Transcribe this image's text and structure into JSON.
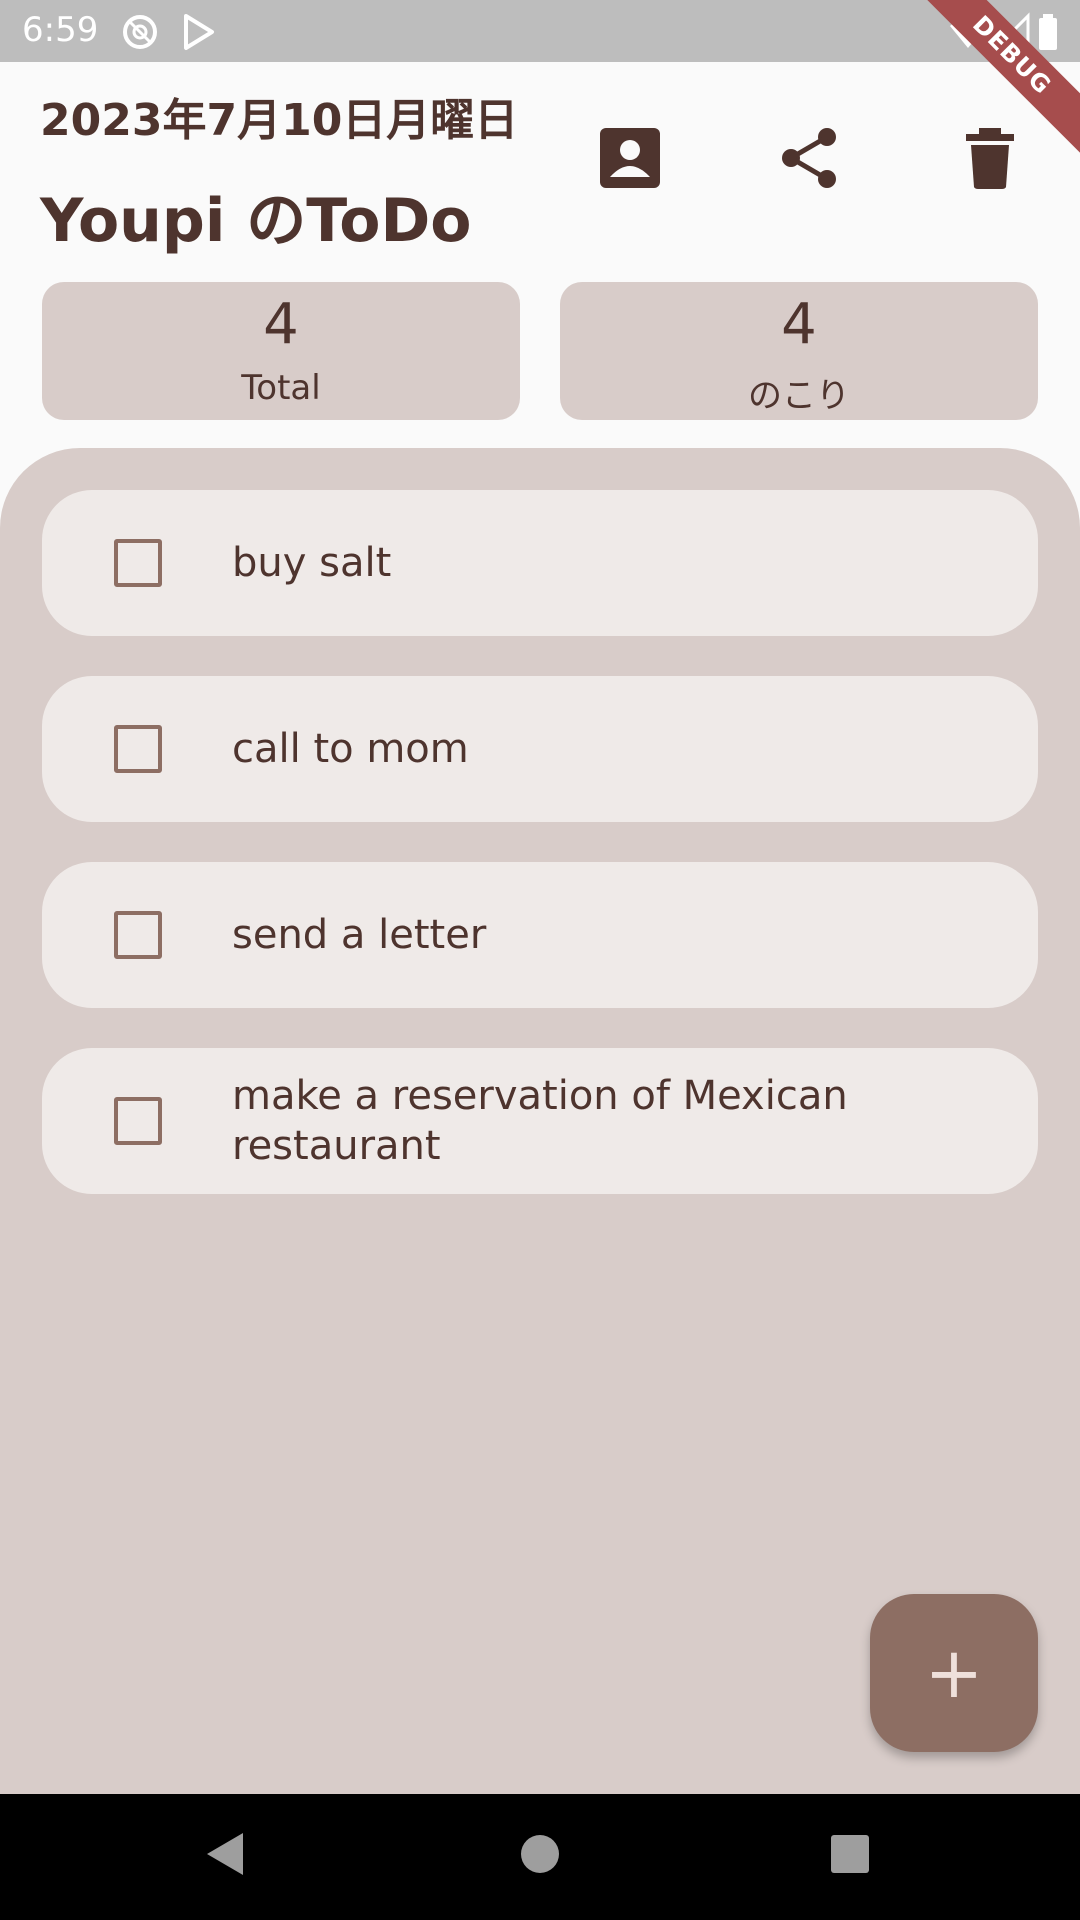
{
  "status_bar": {
    "time": "6:59",
    "debug_label": "DEBUG"
  },
  "header": {
    "date": "2023年7月10日月曜日",
    "title": "Youpi のToDo",
    "actions": [
      {
        "name": "contact-icon"
      },
      {
        "name": "share-icon"
      },
      {
        "name": "delete-icon"
      }
    ]
  },
  "counters": {
    "total": {
      "value": "4",
      "label": "Total"
    },
    "remaining": {
      "value": "4",
      "label": "のこり"
    }
  },
  "todos": [
    {
      "text": "buy salt",
      "checked": false
    },
    {
      "text": "call to mom",
      "checked": false
    },
    {
      "text": "send a letter",
      "checked": false
    },
    {
      "text": "make a reservation of Mexican restaurant",
      "checked": false
    }
  ],
  "fab": {
    "label": "+"
  },
  "colors": {
    "primary_text": "#4e342e",
    "surface": "#d8ccc9",
    "item_bg": "#efeae8",
    "accent": "#8d6e63"
  }
}
